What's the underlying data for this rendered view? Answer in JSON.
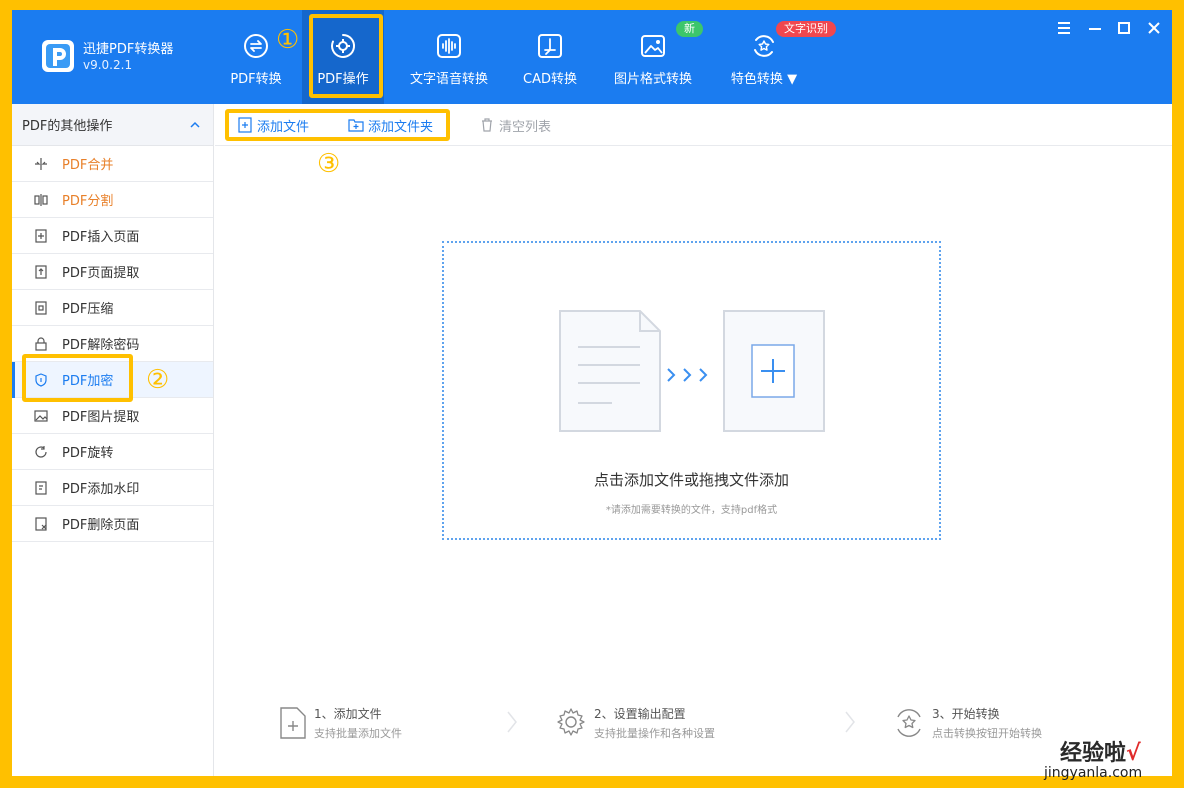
{
  "app": {
    "name": "迅捷PDF转换器",
    "version": "v9.0.2.1"
  },
  "tabs": [
    {
      "label": "PDF转换",
      "icon": "convert-icon"
    },
    {
      "label": "PDF操作",
      "icon": "gear-icon",
      "active": true
    },
    {
      "label": "文字语音转换",
      "icon": "audio-wave-icon"
    },
    {
      "label": "CAD转换",
      "icon": "cad-icon"
    },
    {
      "label": "图片格式转换",
      "icon": "image-icon",
      "badge": "新"
    },
    {
      "label": "特色转换",
      "icon": "star-convert-icon",
      "badge": "文字识别"
    }
  ],
  "sidebar": {
    "title": "PDF的其他操作",
    "items": [
      {
        "label": "PDF合并",
        "icon": "merge-icon"
      },
      {
        "label": "PDF分割",
        "icon": "split-icon"
      },
      {
        "label": "PDF插入页面",
        "icon": "insert-page-icon"
      },
      {
        "label": "PDF页面提取",
        "icon": "extract-page-icon"
      },
      {
        "label": "PDF压缩",
        "icon": "compress-icon"
      },
      {
        "label": "PDF解除密码",
        "icon": "unlock-icon"
      },
      {
        "label": "PDF加密",
        "icon": "shield-icon",
        "active": true
      },
      {
        "label": "PDF图片提取",
        "icon": "image-extract-icon"
      },
      {
        "label": "PDF旋转",
        "icon": "rotate-icon"
      },
      {
        "label": "PDF添加水印",
        "icon": "watermark-icon"
      },
      {
        "label": "PDF删除页面",
        "icon": "delete-page-icon"
      }
    ]
  },
  "toolbar": {
    "add_file": "添加文件",
    "add_folder": "添加文件夹",
    "clear_list": "清空列表"
  },
  "dropzone": {
    "title": "点击添加文件或拖拽文件添加",
    "hint": "*请添加需要转换的文件，支持pdf格式"
  },
  "steps": [
    {
      "title": "1、添加文件",
      "desc": "支持批量添加文件"
    },
    {
      "title": "2、设置输出配置",
      "desc": "支持批量操作和各种设置"
    },
    {
      "title": "3、开始转换",
      "desc": "点击转换按钮开始转换"
    }
  ],
  "annotations": [
    "①",
    "②",
    "③"
  ],
  "watermark": {
    "text": "经验啦",
    "check": "√",
    "url": "jingyanla.com"
  },
  "colors": {
    "primary": "#1b7cf0",
    "highlight": "#ffc000",
    "orange": "#e8802a",
    "badge_green": "#3cc66b",
    "badge_red": "#f0474f"
  }
}
